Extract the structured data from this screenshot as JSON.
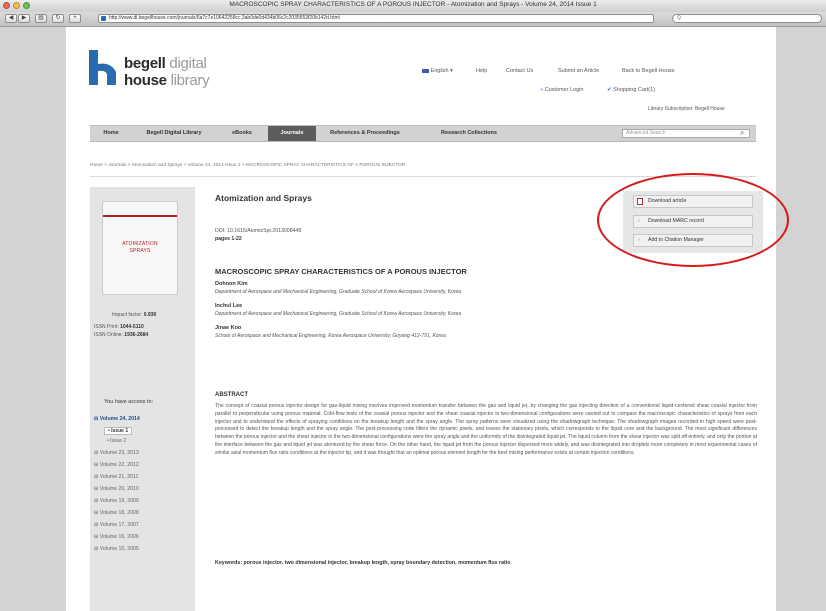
{
  "browser": {
    "window_title": "MACROSCOPIC SPRAY CHARACTERISTICS OF A POROUS INJECTOR - Atomization and Sprays - Volume 24, 2014 Issue 1",
    "url": "http://www.dl.begellhouse.com/journals/6a7c7e10642258cc,3ab0de0d434b06c2c2035653f20b142d.html",
    "search_placeholder": "Q",
    "back": "◀",
    "forward": "▶",
    "reload": "↻",
    "add": "+",
    "sidebar_toggle": "▤"
  },
  "site": {
    "logo_line1_bold": "begell",
    "logo_line1_light": "digital",
    "logo_line2_bold": "house",
    "logo_line2_light": "library",
    "lang": "English",
    "help": "Help",
    "contact": "Contact Us",
    "submit": "Submit an Article",
    "back_to": "Back to Begell House",
    "customer_login": "Customer Login",
    "cart": "Shopping Cart(1)",
    "subscription": "Library Subscription: Begell House"
  },
  "nav": {
    "items": [
      "Home",
      "Begell Digital Library",
      "eBooks",
      "Journals",
      "References & Proceedings",
      "Research Collections"
    ],
    "active_index": 3,
    "search_placeholder": "Advanced Search"
  },
  "breadcrumb": "Home > Journals > Atomization and Sprays > Volume 24, 2014 Issue 1 > MACROSCOPIC SPRAY CHARACTERISTICS OF A POROUS INJECTOR",
  "sidebar": {
    "cover_title1": "ATOMIZATION",
    "cover_title2": "SPRAYS",
    "impact_label": "Impact factor:",
    "impact_value": "0.939",
    "issn_print_label": "ISSN Print:",
    "issn_print": "1044-5110",
    "issn_online_label": "ISSN Online:",
    "issn_online": "1936-2684",
    "access_heading": "You have access to:",
    "volumes": [
      "Volume 24, 2014",
      "Volume 23, 2013",
      "Volume 22, 2012",
      "Volume 21, 2011",
      "Volume 20, 2010",
      "Volume 19, 2009",
      "Volume 18, 2008",
      "Volume 17, 2007",
      "Volume 16, 2006",
      "Volume 15, 2005"
    ],
    "issues": [
      "Issue 1",
      "Issue 2"
    ]
  },
  "article": {
    "journal": "Atomization and Sprays",
    "doi": "DOI: 10.1615/AtomizSpr.2013008448",
    "pages": "pages 1-22",
    "title": "MACROSCOPIC SPRAY CHARACTERISTICS OF A POROUS INJECTOR",
    "authors": [
      {
        "name": "Dohoon Kim",
        "aff": "Department of Aerospace and Mechanical Engineering, Graduate School of Korea Aerospace University, Korea"
      },
      {
        "name": "Inchul Lee",
        "aff": "Department of Aerospace and Mechanical Engineering, Graduate School of Korea Aerospace University, Korea"
      },
      {
        "name": "Jinae Koo",
        "aff": "School of Aerospace and Mechanical Engineering, Korea Aerospace University, Goyang 412-791, Korea"
      }
    ],
    "abstract_heading": "ABSTRACT",
    "abstract": "The concept of coaxial porous injector design for gas-liquid mixing involves improved momentum transfer between the gas and liquid jet, by changing the gas injecting direction of a conventional liquid-centered shear coaxial injector from parallel to perpendicular using porous material. Cold-flow tests of the coaxial porous injector and the shear coaxial injector in two-dimensional configurations were carried out to compare the macroscopic characteristics of sprays from each injector and to understand the effects of spraying conditions on the breakup length and the spray angle. The spray patterns were visualized using the shadowgraph technique. The shadowgraph images recorded in high speed were post-processed to detect the breakup length and the spray angle. The post-processing code filters the dynamic pixels, and leaves the stationary pixels, which corresponds to the liquid core and the background. The most significant differences between the porous injector and the shear injector in the two-dimensional configurations were the spray angle and the uniformity of the disintegrated liquid jet. The liquid column from the shear injector was split off entirely, and only the portion at the interface between the gas and liquid jet was atomized by the shear force. On the other hand, the liquid jet from the porous injector dispersed more widely, and was disintegrated into droplets more completely in most experimental cases of similar axial momentum flux ratio conditions at the injector tip, and it was thought that an optimal porous element length for the best mixing performance exists at certain injection conditions.",
    "keywords": "Keywords: porous injector, two dimensional injector, breakup length, spray boundary detection, momentum flux ratio"
  },
  "actions": {
    "download_article": "Download article",
    "download_marc": "Download MARC record",
    "add_citation": "Add to Citation Manager"
  },
  "colors": {
    "annotation_ring": "#d51b1b",
    "nav_active": "#5c5c5c",
    "logo_blue": "#2a6ab0"
  }
}
